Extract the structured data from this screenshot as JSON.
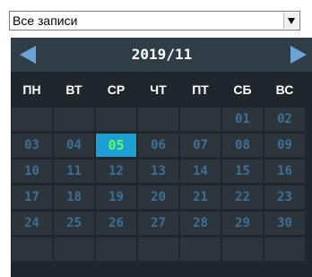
{
  "filter": {
    "selected": "Все записи"
  },
  "calendar": {
    "month_label": "2019/11",
    "weekdays": [
      "ПН",
      "ВТ",
      "СР",
      "ЧТ",
      "ПТ",
      "СБ",
      "ВС"
    ],
    "days": [
      "",
      "",
      "",
      "",
      "",
      "01",
      "02",
      "03",
      "04",
      "05",
      "06",
      "07",
      "08",
      "09",
      "10",
      "11",
      "12",
      "13",
      "14",
      "15",
      "16",
      "17",
      "18",
      "19",
      "20",
      "21",
      "22",
      "23",
      "24",
      "25",
      "26",
      "27",
      "28",
      "29",
      "30",
      "",
      "",
      "",
      "",
      "",
      "",
      ""
    ],
    "selected_day": "05",
    "colors": {
      "background": "#1f272d",
      "header": "#2f3d47",
      "cell": "#2c353c",
      "day_text": "#3f6f93",
      "selected_bg": "#1e9fd3",
      "selected_text": "#5dff5d",
      "nav_arrow": "#6aa3d4"
    }
  },
  "icons": {
    "dropdown": "chevron-down-icon",
    "prev": "arrow-left-icon",
    "next": "arrow-right-icon"
  }
}
